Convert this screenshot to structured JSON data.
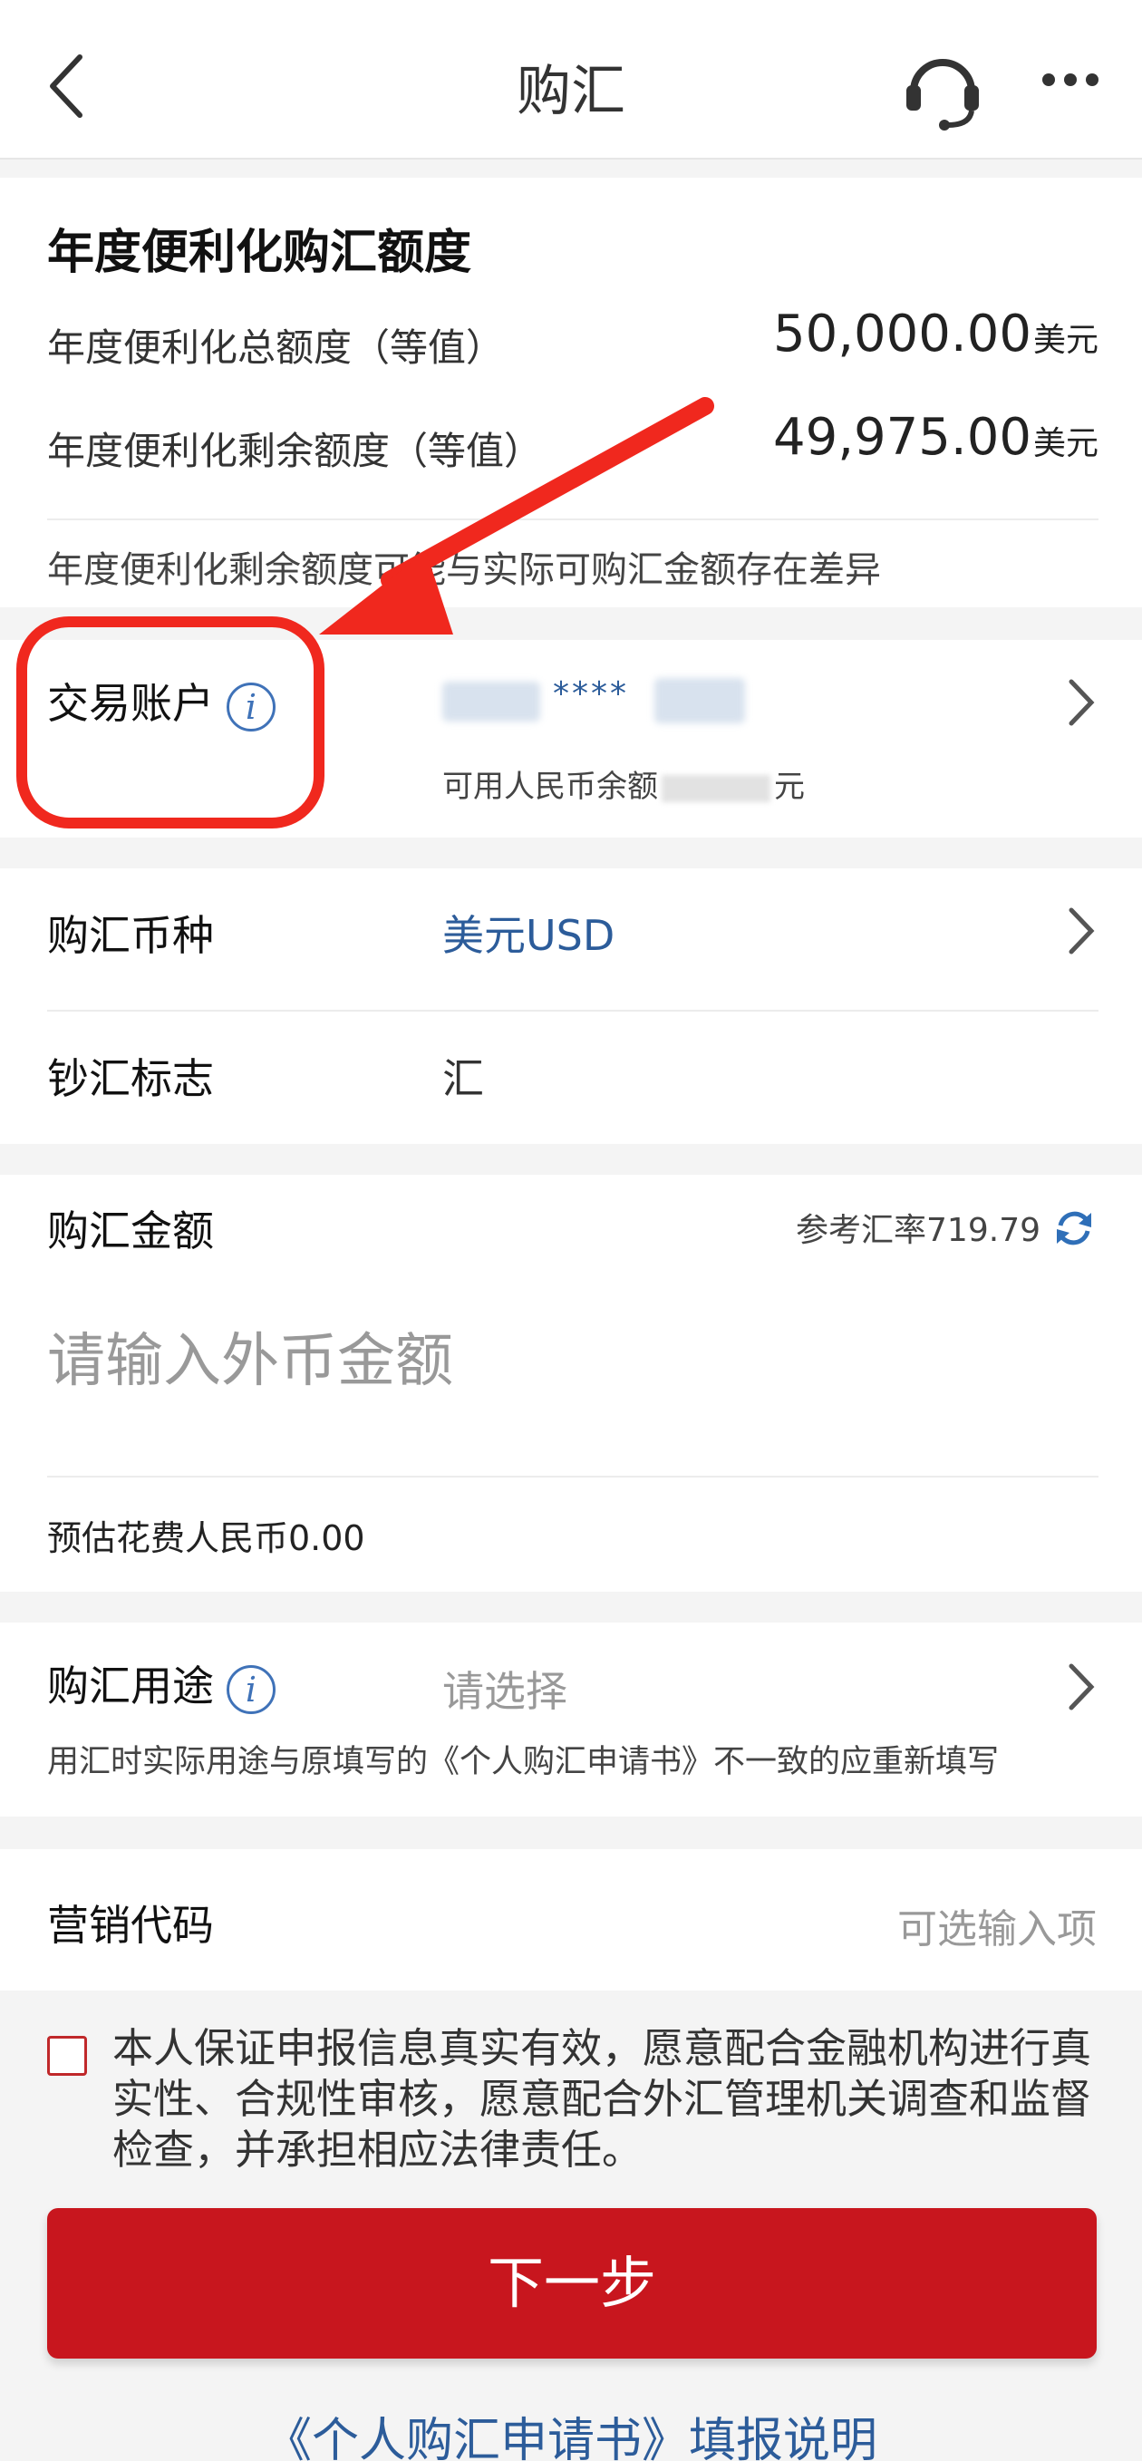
{
  "nav": {
    "title": "购汇"
  },
  "quota": {
    "title": "年度便利化购汇额度",
    "total_label": "年度便利化总额度（等值）",
    "total_value": "50,000.00",
    "total_unit": "美元",
    "remaining_label": "年度便利化剩余额度（等值）",
    "remaining_value": "49,975.00",
    "remaining_unit": "美元",
    "note": "年度便利化剩余额度可能与实际可购汇金额存在差异"
  },
  "account": {
    "label": "交易账户",
    "masked": "****",
    "available_prefix": "可用人民币余额",
    "available_suffix": "元"
  },
  "currency": {
    "label": "购汇币种",
    "value": "美元USD"
  },
  "cash_flag": {
    "label": "钞汇标志",
    "value": "汇"
  },
  "amount": {
    "label": "购汇金额",
    "rate_text": "参考汇率719.79",
    "placeholder": "请输入外币金额",
    "estimate": "预估花费人民币0.00"
  },
  "purpose": {
    "label": "购汇用途",
    "placeholder": "请选择",
    "note": "用汇时实际用途与原填写的《个人购汇申请书》不一致的应重新填写"
  },
  "marketing": {
    "label": "营销代码",
    "placeholder": "可选输入项"
  },
  "declaration": "本人保证申报信息真实有效，愿意配合金融机构进行真实性、合规性审核，愿意配合外汇管理机关调查和监督检查，并承担相应法律责任。",
  "next_button": "下一步",
  "bottom_link": "《个人购汇申请书》填报说明",
  "colors": {
    "brand_red": "#c8161e",
    "link_blue": "#2c5c9a",
    "annotation_red": "#f0281e"
  }
}
